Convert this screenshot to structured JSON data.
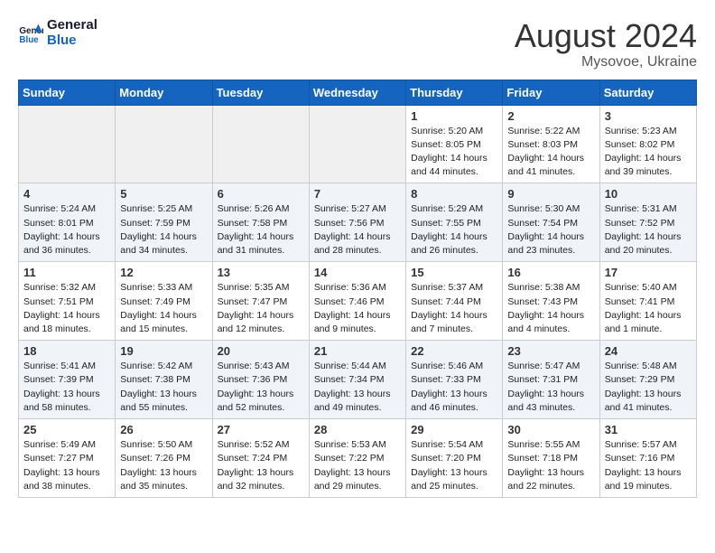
{
  "logo": {
    "line1": "General",
    "line2": "Blue"
  },
  "title": "August 2024",
  "subtitle": "Mysovoe, Ukraine",
  "days_of_week": [
    "Sunday",
    "Monday",
    "Tuesday",
    "Wednesday",
    "Thursday",
    "Friday",
    "Saturday"
  ],
  "weeks": [
    [
      {
        "day": "",
        "empty": true
      },
      {
        "day": "",
        "empty": true
      },
      {
        "day": "",
        "empty": true
      },
      {
        "day": "",
        "empty": true
      },
      {
        "day": "1",
        "sunrise": "5:20 AM",
        "sunset": "8:05 PM",
        "daylight": "14 hours and 44 minutes."
      },
      {
        "day": "2",
        "sunrise": "5:22 AM",
        "sunset": "8:03 PM",
        "daylight": "14 hours and 41 minutes."
      },
      {
        "day": "3",
        "sunrise": "5:23 AM",
        "sunset": "8:02 PM",
        "daylight": "14 hours and 39 minutes."
      }
    ],
    [
      {
        "day": "4",
        "sunrise": "5:24 AM",
        "sunset": "8:01 PM",
        "daylight": "14 hours and 36 minutes."
      },
      {
        "day": "5",
        "sunrise": "5:25 AM",
        "sunset": "7:59 PM",
        "daylight": "14 hours and 34 minutes."
      },
      {
        "day": "6",
        "sunrise": "5:26 AM",
        "sunset": "7:58 PM",
        "daylight": "14 hours and 31 minutes."
      },
      {
        "day": "7",
        "sunrise": "5:27 AM",
        "sunset": "7:56 PM",
        "daylight": "14 hours and 28 minutes."
      },
      {
        "day": "8",
        "sunrise": "5:29 AM",
        "sunset": "7:55 PM",
        "daylight": "14 hours and 26 minutes."
      },
      {
        "day": "9",
        "sunrise": "5:30 AM",
        "sunset": "7:54 PM",
        "daylight": "14 hours and 23 minutes."
      },
      {
        "day": "10",
        "sunrise": "5:31 AM",
        "sunset": "7:52 PM",
        "daylight": "14 hours and 20 minutes."
      }
    ],
    [
      {
        "day": "11",
        "sunrise": "5:32 AM",
        "sunset": "7:51 PM",
        "daylight": "14 hours and 18 minutes."
      },
      {
        "day": "12",
        "sunrise": "5:33 AM",
        "sunset": "7:49 PM",
        "daylight": "14 hours and 15 minutes."
      },
      {
        "day": "13",
        "sunrise": "5:35 AM",
        "sunset": "7:47 PM",
        "daylight": "14 hours and 12 minutes."
      },
      {
        "day": "14",
        "sunrise": "5:36 AM",
        "sunset": "7:46 PM",
        "daylight": "14 hours and 9 minutes."
      },
      {
        "day": "15",
        "sunrise": "5:37 AM",
        "sunset": "7:44 PM",
        "daylight": "14 hours and 7 minutes."
      },
      {
        "day": "16",
        "sunrise": "5:38 AM",
        "sunset": "7:43 PM",
        "daylight": "14 hours and 4 minutes."
      },
      {
        "day": "17",
        "sunrise": "5:40 AM",
        "sunset": "7:41 PM",
        "daylight": "14 hours and 1 minute."
      }
    ],
    [
      {
        "day": "18",
        "sunrise": "5:41 AM",
        "sunset": "7:39 PM",
        "daylight": "13 hours and 58 minutes."
      },
      {
        "day": "19",
        "sunrise": "5:42 AM",
        "sunset": "7:38 PM",
        "daylight": "13 hours and 55 minutes."
      },
      {
        "day": "20",
        "sunrise": "5:43 AM",
        "sunset": "7:36 PM",
        "daylight": "13 hours and 52 minutes."
      },
      {
        "day": "21",
        "sunrise": "5:44 AM",
        "sunset": "7:34 PM",
        "daylight": "13 hours and 49 minutes."
      },
      {
        "day": "22",
        "sunrise": "5:46 AM",
        "sunset": "7:33 PM",
        "daylight": "13 hours and 46 minutes."
      },
      {
        "day": "23",
        "sunrise": "5:47 AM",
        "sunset": "7:31 PM",
        "daylight": "13 hours and 43 minutes."
      },
      {
        "day": "24",
        "sunrise": "5:48 AM",
        "sunset": "7:29 PM",
        "daylight": "13 hours and 41 minutes."
      }
    ],
    [
      {
        "day": "25",
        "sunrise": "5:49 AM",
        "sunset": "7:27 PM",
        "daylight": "13 hours and 38 minutes."
      },
      {
        "day": "26",
        "sunrise": "5:50 AM",
        "sunset": "7:26 PM",
        "daylight": "13 hours and 35 minutes."
      },
      {
        "day": "27",
        "sunrise": "5:52 AM",
        "sunset": "7:24 PM",
        "daylight": "13 hours and 32 minutes."
      },
      {
        "day": "28",
        "sunrise": "5:53 AM",
        "sunset": "7:22 PM",
        "daylight": "13 hours and 29 minutes."
      },
      {
        "day": "29",
        "sunrise": "5:54 AM",
        "sunset": "7:20 PM",
        "daylight": "13 hours and 25 minutes."
      },
      {
        "day": "30",
        "sunrise": "5:55 AM",
        "sunset": "7:18 PM",
        "daylight": "13 hours and 22 minutes."
      },
      {
        "day": "31",
        "sunrise": "5:57 AM",
        "sunset": "7:16 PM",
        "daylight": "13 hours and 19 minutes."
      }
    ]
  ],
  "daylight_label": "Daylight:",
  "sunrise_label": "Sunrise:",
  "sunset_label": "Sunset:"
}
